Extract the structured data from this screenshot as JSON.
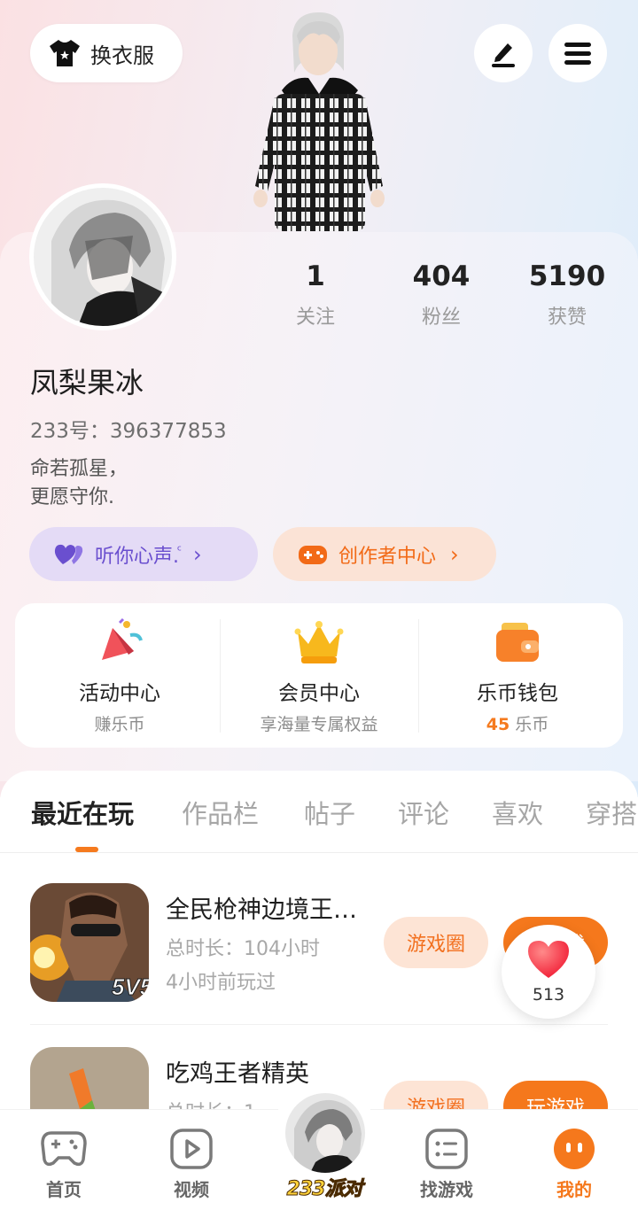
{
  "header": {
    "outfit_label": "换衣服",
    "edit_icon": "pen-icon",
    "menu_icon": "hamburger-icon"
  },
  "profile": {
    "stats": [
      {
        "value": "1",
        "label": "关注"
      },
      {
        "value": "404",
        "label": "粉丝"
      },
      {
        "value": "5190",
        "label": "获赞"
      }
    ],
    "nickname": "凤梨果冰",
    "uid": "233号：396377853",
    "bio": "命若孤星，\n更愿守你.",
    "voice_pill": "听你心声.ⷭ",
    "creator_pill": "创作者中心"
  },
  "quick_panel": [
    {
      "title": "活动中心",
      "sub": "赚乐币",
      "icon": "gift-flag-icon"
    },
    {
      "title": "会员中心",
      "sub": "享海量专属权益",
      "icon": "crown-icon"
    },
    {
      "title": "乐币钱包",
      "sub_num": "45",
      "sub_unit": " 乐币",
      "icon": "wallet-icon"
    }
  ],
  "tabs": [
    "最近在玩",
    "作品栏",
    "帖子",
    "评论",
    "喜欢",
    "穿搭"
  ],
  "games": [
    {
      "name": "全民枪神边境王…",
      "total": "总时长：104小时",
      "last": "4小时前玩过",
      "circle_btn": "游戏圈",
      "play_btn": "玩游戏"
    },
    {
      "name": "吃鸡王者精英",
      "total": "总时长：1",
      "last": "",
      "circle_btn": "游戏圈",
      "play_btn": "玩游戏"
    }
  ],
  "like_float": {
    "count": "513"
  },
  "bottom_nav": {
    "home": "首页",
    "video": "视频",
    "center": "233派对",
    "find": "找游戏",
    "mine": "我的"
  },
  "colors": {
    "accent": "#f5781c",
    "voice": "#6a4fcf",
    "voice_bg": "#e4dbf6",
    "creator_bg": "#fbe3d6"
  }
}
